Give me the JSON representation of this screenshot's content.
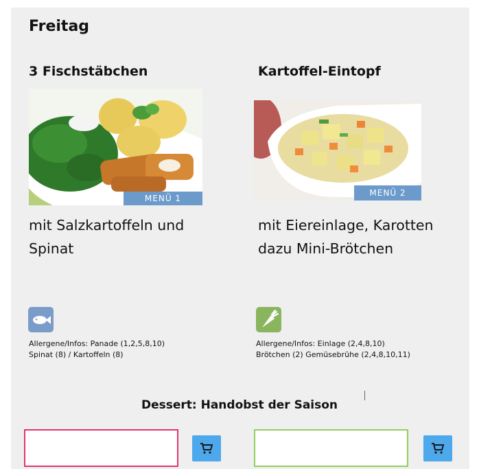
{
  "day": {
    "title": "Freitag"
  },
  "menus": [
    {
      "title": "3 Fischstäbchen",
      "tag": "MENÜ 1",
      "description_line1": "mit Salzkartoffeln und",
      "description_line2": "Spinat",
      "diet_icon": "fish-icon",
      "allergen_line1": "Allergene/Infos: Panade (1,2,5,8,10)",
      "allergen_line2": "Spinat (8) / Kartoffeln (8)",
      "input_border_color": "#e2336b"
    },
    {
      "title": "Kartoffel-Eintopf",
      "tag": "MENÜ 2",
      "description_line1": "mit Eiereinlage, Karotten",
      "description_line2": "dazu Mini-Brötchen",
      "diet_icon": "carrot-icon",
      "allergen_line1": "Allergene/Infos: Einlage (2,4,8,10)",
      "allergen_line2": "Brötchen (2) Gemüsebrühe (2,4,8,10,11)",
      "input_border_color": "#8fce5c"
    }
  ],
  "dessert": {
    "label": "Dessert: Handobst der Saison"
  },
  "colors": {
    "accent_blue": "#4da8ec",
    "tag_blue": "#6b9acb",
    "panel": "#efefef"
  }
}
